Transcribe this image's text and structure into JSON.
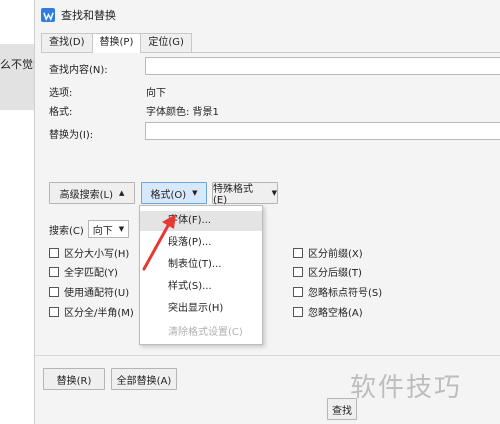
{
  "background": {
    "doc_text": "么不觉时"
  },
  "dialog": {
    "title": "查找和替换",
    "tabs": [
      "查找(D)",
      "替换(P)",
      "定位(G)"
    ],
    "find_label": "查找内容(N):",
    "find_value": "",
    "options_label": "选项:",
    "options_value": "向下",
    "format_label": "格式:",
    "format_value": "字体颜色: 背景1",
    "replace_label": "替换为(I):",
    "replace_value": "",
    "advanced_search": "高级搜索(L)",
    "format_button": "格式(O)",
    "special_format": "特殊格式(E)",
    "search_label": "搜索(C)",
    "search_select": "向下",
    "checkboxes_left": [
      "区分大小写(H)",
      "全字匹配(Y)",
      "使用通配符(U)",
      "区分全/半角(M)"
    ],
    "checkboxes_right": [
      "区分前缀(X)",
      "区分后缀(T)",
      "忽略标点符号(S)",
      "忽略空格(A)"
    ],
    "replace_button": "替换(R)",
    "replace_all_button": "全部替换(A)",
    "find_next_partial": "查找"
  },
  "format_menu": {
    "items": [
      "字体(F)...",
      "段落(P)...",
      "制表位(T)...",
      "样式(S)...",
      "突出显示(H)",
      "清除格式设置(C)"
    ]
  },
  "watermark": "软件技巧",
  "colors": {
    "accent": "#2f7de1",
    "arrow": "#e53935"
  }
}
